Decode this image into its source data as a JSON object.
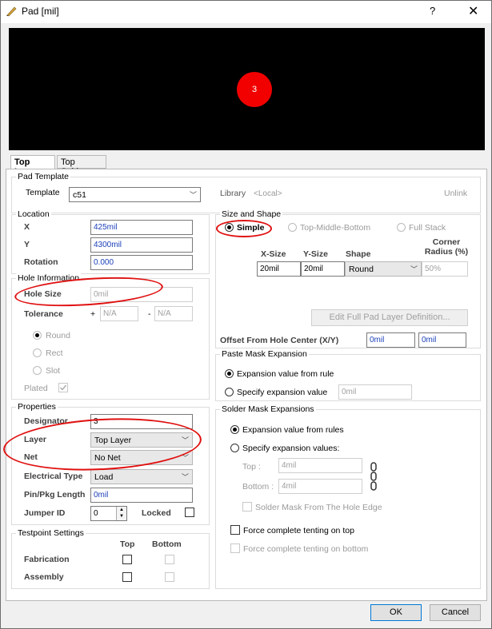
{
  "window": {
    "title": "Pad [mil]",
    "help": "?",
    "close": "✕"
  },
  "preview": {
    "pad_label": "3"
  },
  "tabs": [
    "Top Layer",
    "Top Solder"
  ],
  "pad_template": {
    "title": "Pad Template",
    "template_label": "Template",
    "template_value": "c51",
    "library_label": "Library",
    "library_value": "<Local>",
    "unlink": "Unlink"
  },
  "location": {
    "title": "Location",
    "x_label": "X",
    "x_value": "425mil",
    "y_label": "Y",
    "y_value": "4300mil",
    "rotation_label": "Rotation",
    "rotation_value": "0.000"
  },
  "hole": {
    "title": "Hole Information",
    "hole_size_label": "Hole Size",
    "hole_size_value": "0mil",
    "tolerance_label": "Tolerance",
    "plus": "+",
    "plus_value": "N/A",
    "minus": "-",
    "minus_value": "N/A",
    "round": "Round",
    "rect": "Rect",
    "slot": "Slot",
    "plated_label": "Plated"
  },
  "properties": {
    "title": "Properties",
    "designator_label": "Designator",
    "designator_value": "3",
    "layer_label": "Layer",
    "layer_value": "Top Layer",
    "net_label": "Net",
    "net_value": "No Net",
    "electrical_label": "Electrical Type",
    "electrical_value": "Load",
    "pin_label": "Pin/Pkg Length",
    "pin_value": "0mil",
    "jumper_label": "Jumper ID",
    "jumper_value": "0",
    "locked_label": "Locked"
  },
  "testpoint": {
    "title": "Testpoint Settings",
    "top": "Top",
    "bottom": "Bottom",
    "fabrication": "Fabrication",
    "assembly": "Assembly"
  },
  "size_shape": {
    "title": "Size and Shape",
    "simple": "Simple",
    "tmb": "Top-Middle-Bottom",
    "full_stack": "Full Stack",
    "xsize_label": "X-Size",
    "ysize_label": "Y-Size",
    "shape_label": "Shape",
    "corner_label": "Corner\nRadius (%)",
    "xsize_value": "20mil",
    "ysize_value": "20mil",
    "shape_value": "Round",
    "corner_value": "50%",
    "edit_full": "Edit Full Pad Layer Definition...",
    "offset_label": "Offset From Hole Center (X/Y)",
    "offset_x": "0mil",
    "offset_y": "0mil"
  },
  "paste": {
    "title": "Paste Mask Expansion",
    "rule": "Expansion value from rule",
    "specify": "Specify expansion value",
    "value": "0mil"
  },
  "solder": {
    "title": "Solder Mask Expansions",
    "rules": "Expansion value from rules",
    "specify": "Specify expansion values:",
    "top_label": "Top :",
    "top_value": "4mil",
    "bottom_label": "Bottom :",
    "bottom_value": "4mil",
    "from_hole": "Solder Mask From The Hole Edge",
    "tent_top": "Force complete tenting on top",
    "tent_bottom": "Force complete tenting on bottom"
  },
  "buttons": {
    "ok": "OK",
    "cancel": "Cancel"
  },
  "colors": {
    "pad": "#f20000",
    "annotation": "#e01010"
  }
}
